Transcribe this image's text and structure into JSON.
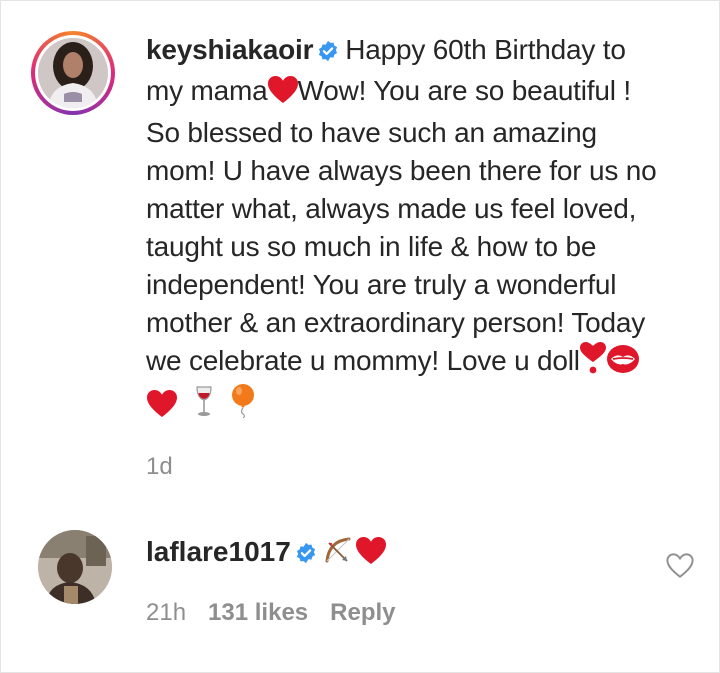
{
  "post_caption": {
    "username": "keyshiakaoir",
    "verified": true,
    "lines": [
      "Happy 60th Birthday to",
      "my mama",
      "Wow! You are so beautiful !",
      "So blessed to have such an amazing",
      "mom! U have always been there for us no",
      "matter what, always made us feel loved,",
      "taught us so much in life & how to be",
      "independent! You are truly a wonderful",
      "mother & an extraordinary person! Today",
      "we celebrate u mommy! Love u doll"
    ],
    "emojis": [
      "heart-emoji",
      "heart-exclamation-emoji",
      "kiss-mark-emoji",
      "heart-emoji",
      "wine-glass-emoji",
      "balloon-emoji"
    ],
    "time_ago": "1d"
  },
  "comment": {
    "username": "laflare1017",
    "verified": true,
    "emojis": [
      "bow-and-arrow-emoji",
      "heart-emoji"
    ],
    "time_ago": "21h",
    "likes": "131 likes",
    "reply_label": "Reply"
  },
  "colors": {
    "text": "#262626",
    "muted": "#8e8e8e",
    "verified_blue": "#3897f0",
    "heart_red": "#e0162b"
  }
}
